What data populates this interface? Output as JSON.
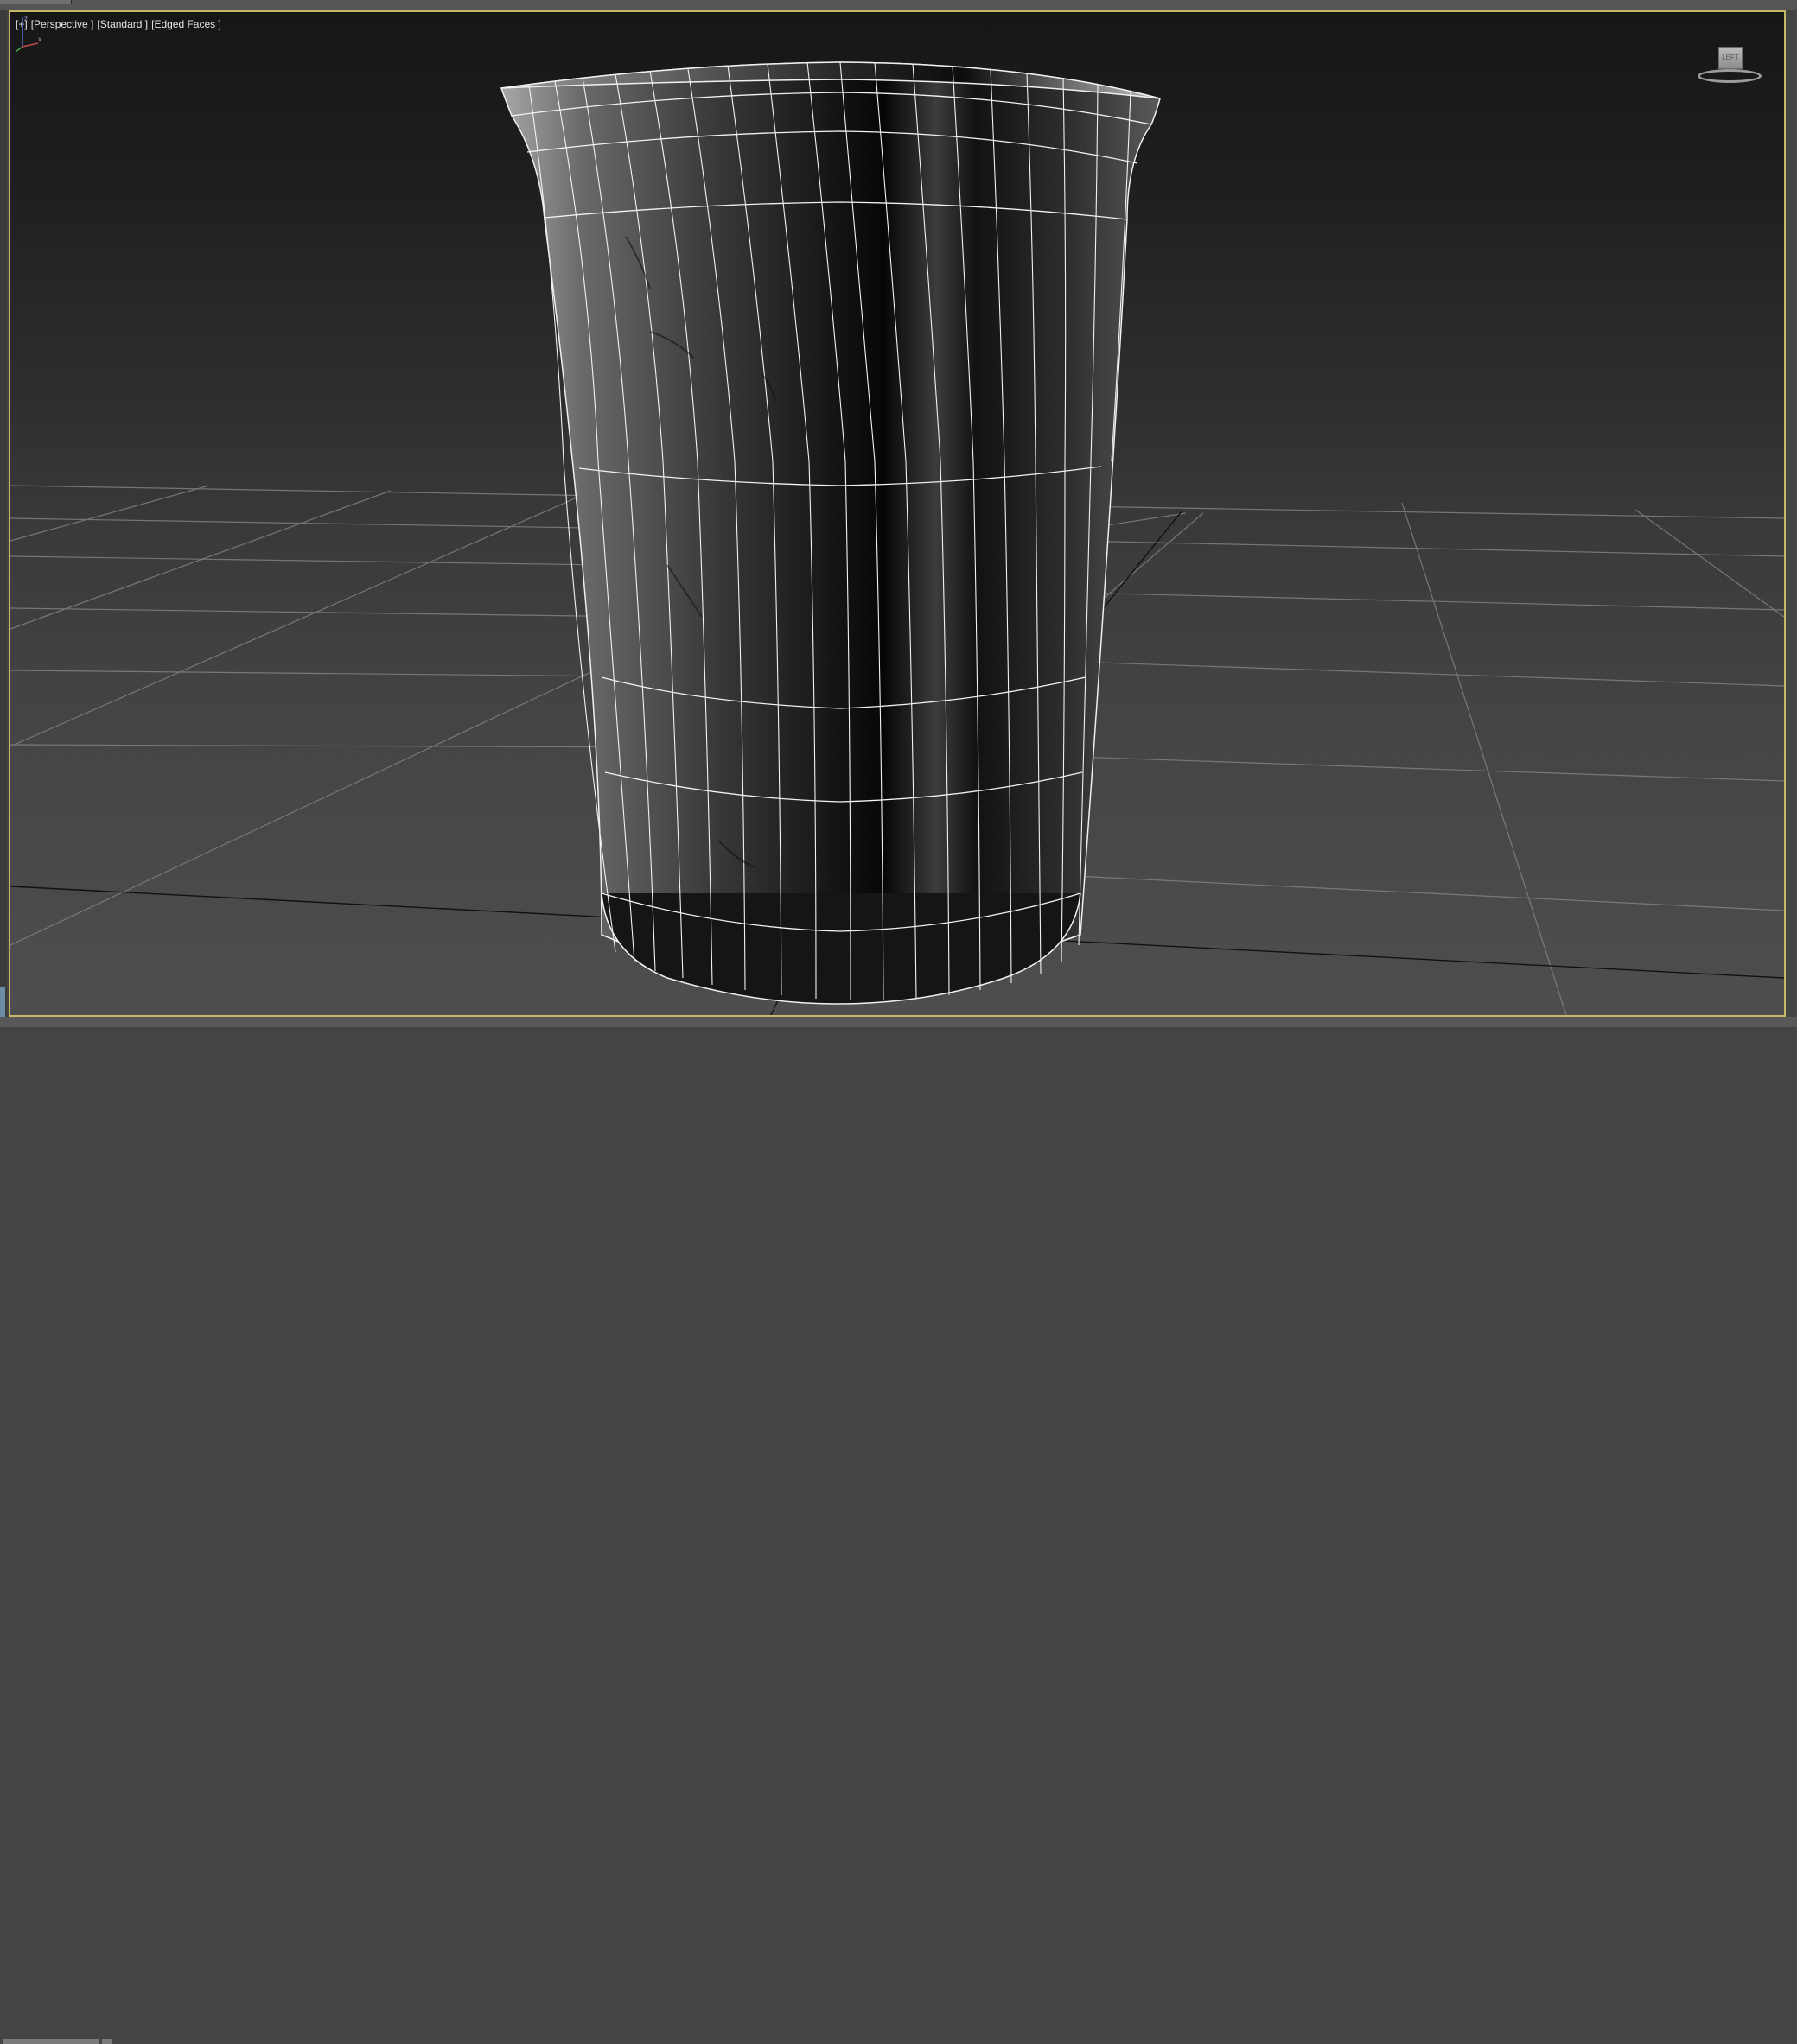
{
  "viewport": {
    "labels": [
      "[+]",
      "[Perspective ]",
      "[Standard ]",
      "[Edged Faces ]"
    ],
    "viewcube_label": "LEFT",
    "border_color": "#c4b766"
  },
  "scene": {
    "object": "cup mesh",
    "material": "dark marble",
    "grid_color": "#8a8a8a"
  },
  "axis_tripod": {
    "x": "x",
    "y": "y",
    "z": "z"
  }
}
